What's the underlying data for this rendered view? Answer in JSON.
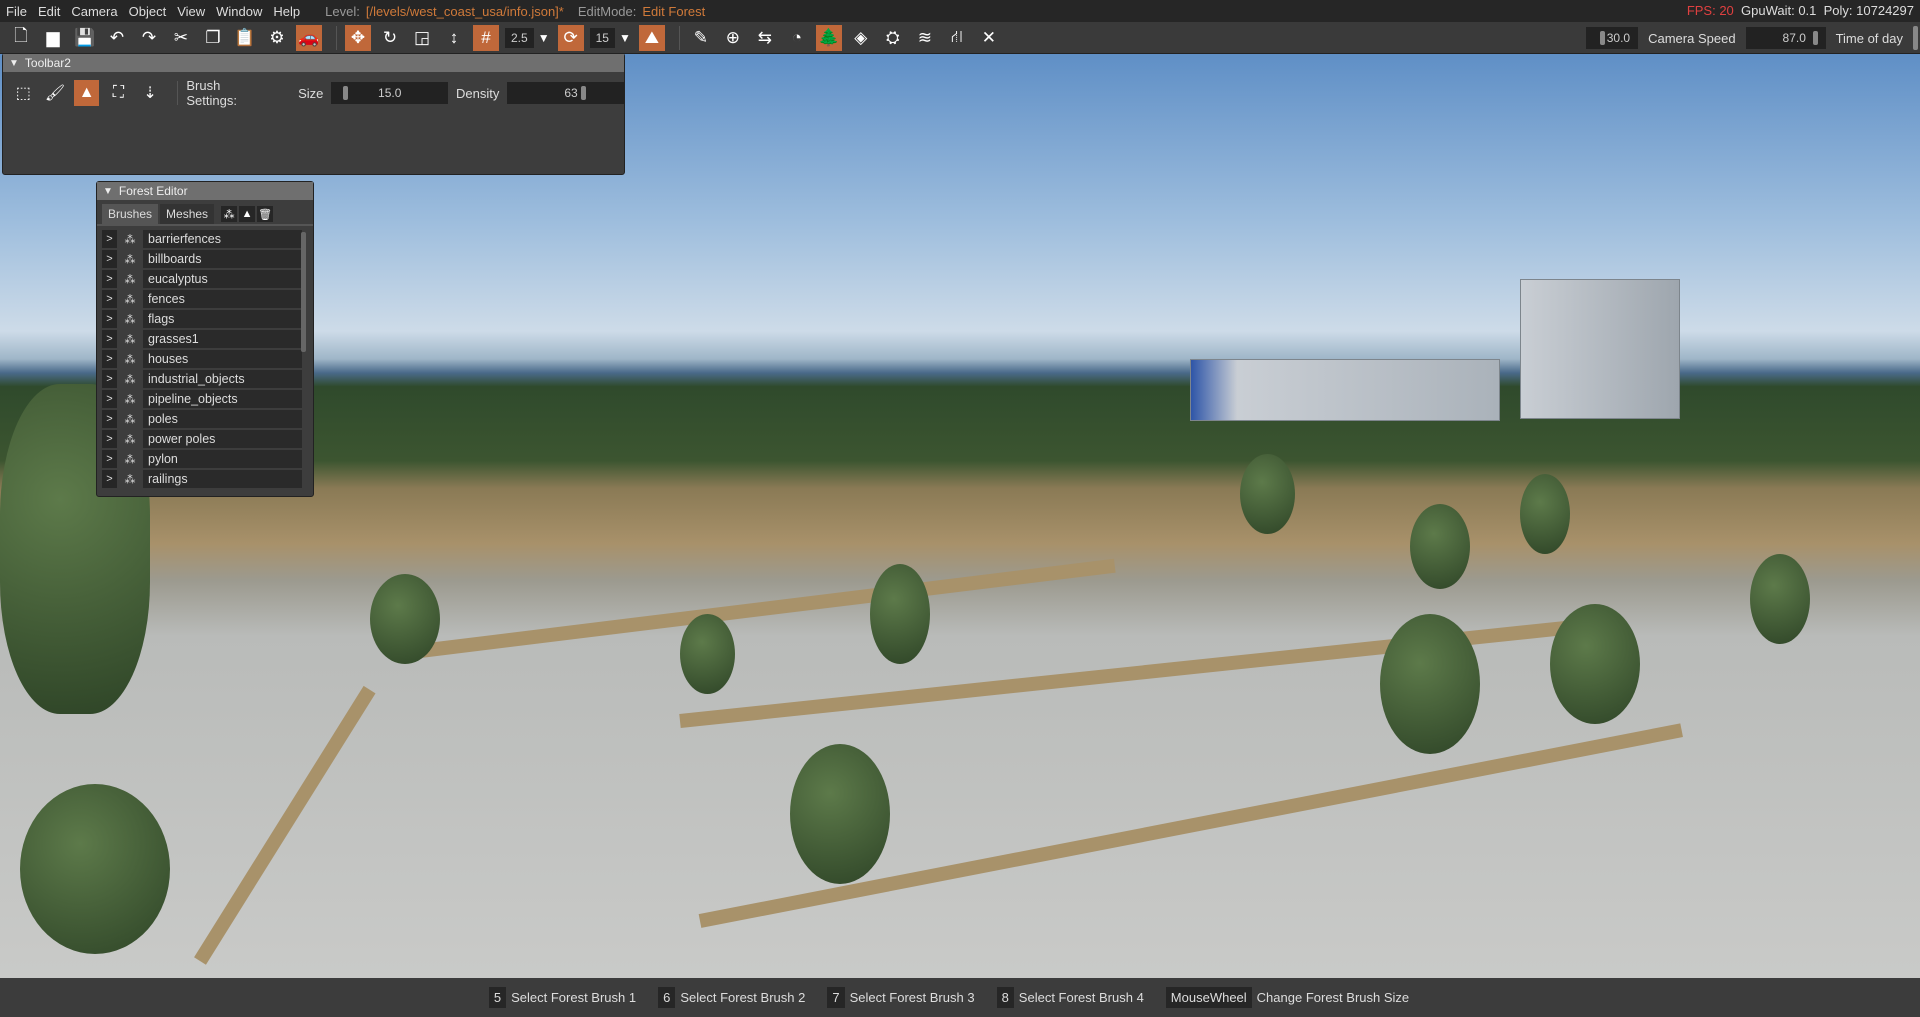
{
  "menu": {
    "items": [
      "File",
      "Edit",
      "Camera",
      "Object",
      "View",
      "Window",
      "Help"
    ],
    "level_label": "Level:",
    "level_value": "[/levels/west_coast_usa/info.json]*",
    "editmode_label": "EditMode:",
    "editmode_value": "Edit Forest"
  },
  "stats": {
    "fps": "FPS: 20",
    "gpuwait": "GpuWait: 0.1",
    "poly": "Poly: 10724297"
  },
  "toolbar": {
    "snap_value": "2.5",
    "rotate_value": "15",
    "camera_speed_value": "30.0",
    "camera_speed_label": "Camera Speed",
    "time_value": "87.0",
    "time_label": "Time of day"
  },
  "toolbar2": {
    "title": "Toolbar2",
    "brush_settings_label": "Brush Settings:",
    "size_label": "Size",
    "size_value": "15.0",
    "density_label": "Density",
    "density_value": "63"
  },
  "forest_editor": {
    "title": "Forest Editor",
    "tabs": [
      "Brushes",
      "Meshes"
    ],
    "items": [
      "barrierfences",
      "billboards",
      "eucalyptus",
      "fences",
      "flags",
      "grasses1",
      "houses",
      "industrial_objects",
      "pipeline_objects",
      "poles",
      "power poles",
      "pylon",
      "railings"
    ]
  },
  "shortcuts": [
    {
      "key": "5",
      "label": "Select Forest Brush 1"
    },
    {
      "key": "6",
      "label": "Select Forest Brush 2"
    },
    {
      "key": "7",
      "label": "Select Forest Brush 3"
    },
    {
      "key": "8",
      "label": "Select Forest Brush 4"
    },
    {
      "key": "MouseWheel",
      "label": "Change Forest Brush Size"
    }
  ],
  "colors": {
    "accent": "#c0683a",
    "fps": "#e04040",
    "level": "#d07a3a"
  }
}
